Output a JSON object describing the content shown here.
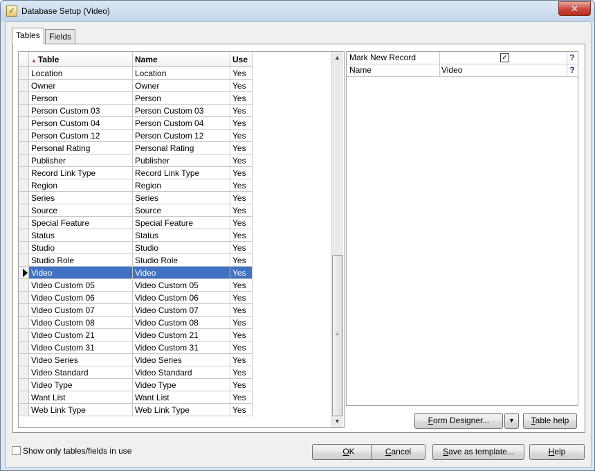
{
  "window": {
    "title": "Database Setup (Video)",
    "close_label": "✕",
    "title_icon": "✓"
  },
  "tabs": [
    {
      "label": "Tables",
      "active": true
    },
    {
      "label": "Fields",
      "active": false
    }
  ],
  "grid": {
    "columns": [
      "Table",
      "Name",
      "Use"
    ],
    "sort_indicator": "▲",
    "rows": [
      {
        "table": "Location",
        "name": "Location",
        "use": "Yes"
      },
      {
        "table": "Owner",
        "name": "Owner",
        "use": "Yes"
      },
      {
        "table": "Person",
        "name": "Person",
        "use": "Yes"
      },
      {
        "table": "Person Custom 03",
        "name": "Person Custom 03",
        "use": "Yes"
      },
      {
        "table": "Person Custom 04",
        "name": "Person Custom 04",
        "use": "Yes"
      },
      {
        "table": "Person Custom 12",
        "name": "Person Custom 12",
        "use": "Yes"
      },
      {
        "table": "Personal Rating",
        "name": "Personal Rating",
        "use": "Yes"
      },
      {
        "table": "Publisher",
        "name": "Publisher",
        "use": "Yes"
      },
      {
        "table": "Record Link Type",
        "name": "Record Link Type",
        "use": "Yes"
      },
      {
        "table": "Region",
        "name": "Region",
        "use": "Yes"
      },
      {
        "table": "Series",
        "name": "Series",
        "use": "Yes"
      },
      {
        "table": "Source",
        "name": "Source",
        "use": "Yes"
      },
      {
        "table": "Special Feature",
        "name": "Special Feature",
        "use": "Yes"
      },
      {
        "table": "Status",
        "name": "Status",
        "use": "Yes"
      },
      {
        "table": "Studio",
        "name": "Studio",
        "use": "Yes"
      },
      {
        "table": "Studio Role",
        "name": "Studio Role",
        "use": "Yes"
      },
      {
        "table": "Video",
        "name": "Video",
        "use": "Yes",
        "selected": true
      },
      {
        "table": "Video Custom 05",
        "name": "Video Custom 05",
        "use": "Yes"
      },
      {
        "table": "Video Custom 06",
        "name": "Video Custom 06",
        "use": "Yes"
      },
      {
        "table": "Video Custom 07",
        "name": "Video Custom 07",
        "use": "Yes"
      },
      {
        "table": "Video Custom 08",
        "name": "Video Custom 08",
        "use": "Yes"
      },
      {
        "table": "Video Custom 21",
        "name": "Video Custom 21",
        "use": "Yes"
      },
      {
        "table": "Video Custom 31",
        "name": "Video Custom 31",
        "use": "Yes"
      },
      {
        "table": "Video Series",
        "name": "Video Series",
        "use": "Yes"
      },
      {
        "table": "Video Standard",
        "name": "Video Standard",
        "use": "Yes"
      },
      {
        "table": "Video Type",
        "name": "Video Type",
        "use": "Yes"
      },
      {
        "table": "Want List",
        "name": "Want List",
        "use": "Yes"
      },
      {
        "table": "Web Link Type",
        "name": "Web Link Type",
        "use": "Yes"
      }
    ],
    "scrollbar": {
      "up_icon": "▲",
      "down_icon": "▼",
      "grip_icon": "≡"
    }
  },
  "properties": {
    "help_label": "?",
    "items": [
      {
        "label": "Mark New Record",
        "value": "",
        "checked": true,
        "check_glyph": "✓"
      },
      {
        "label": "Name",
        "value": "Video"
      }
    ]
  },
  "buttons": {
    "form_designer": {
      "label_pre": "",
      "label_u": "F",
      "label_post": "orm Designer..."
    },
    "form_designer_dropdown": "▼",
    "table_help": {
      "label_pre": "",
      "label_u": "T",
      "label_post": "able help"
    },
    "ok": {
      "label_pre": "",
      "label_u": "O",
      "label_post": "K"
    },
    "cancel": {
      "label_pre": "",
      "label_u": "C",
      "label_post": "ancel"
    },
    "save_template": {
      "label_pre": "",
      "label_u": "S",
      "label_post": "ave as template..."
    },
    "help": {
      "label_pre": "",
      "label_u": "H",
      "label_post": "elp"
    }
  },
  "footer": {
    "show_only_label": "Show only tables/fields in use",
    "show_only_checked": false
  }
}
